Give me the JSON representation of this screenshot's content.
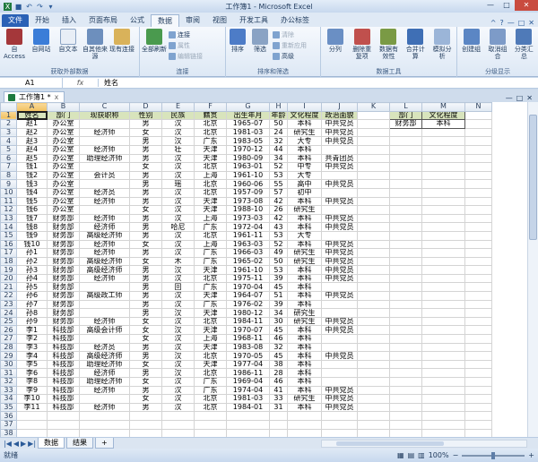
{
  "app": {
    "title": "工作簿1 - Microsoft Excel"
  },
  "tabs": [
    "文件",
    "开始",
    "插入",
    "页面布局",
    "公式",
    "数据",
    "审阅",
    "视图",
    "开发工具",
    "办公标签"
  ],
  "active_tab": "数据",
  "ribbon": {
    "external": {
      "name": "获取外部数据",
      "buttons": [
        "自 Access",
        "自网站",
        "自文本",
        "自其他来源",
        "现有连接"
      ]
    },
    "connections": {
      "name": "连接",
      "big": "全部刷新",
      "small": [
        "连接",
        "属性",
        "编辑链接"
      ]
    },
    "sortfilter": {
      "name": "排序和筛选",
      "big": [
        "排序",
        "筛选"
      ],
      "small": [
        "清除",
        "重新应用",
        "高级"
      ]
    },
    "datatools": {
      "name": "数据工具",
      "big": [
        "分列",
        "删除重复项",
        "数据有效性",
        "合并计算",
        "模拟分析"
      ]
    },
    "outline": {
      "name": "分级显示",
      "big": [
        "创建组",
        "取消组合",
        "分类汇总"
      ]
    }
  },
  "formula": {
    "namebox": "A1",
    "fx": "fx",
    "value": "姓名"
  },
  "workbook_tab": {
    "label": "工作簿1 *",
    "close": "x"
  },
  "grid": {
    "columns": [
      "A",
      "B",
      "C",
      "D",
      "E",
      "F",
      "G",
      "H",
      "I",
      "J",
      "K",
      "L",
      "M",
      "N"
    ],
    "rows": [
      [
        "姓名",
        "部门",
        "现获职称",
        "性别",
        "民族",
        "籍贯",
        "出生年月",
        "年龄",
        "文化程度",
        "政治面貌",
        "",
        "部门",
        "文化程度",
        ""
      ],
      [
        "赵1",
        "办公室",
        "",
        "男",
        "汉",
        "北京",
        "1965-07",
        "50",
        "本科",
        "中共党员",
        "",
        "财务部",
        "本科",
        ""
      ],
      [
        "赵2",
        "办公室",
        "经济师",
        "女",
        "汉",
        "北京",
        "1981-03",
        "24",
        "研究生",
        "中共党员",
        "",
        "",
        "",
        ""
      ],
      [
        "赵3",
        "办公室",
        "",
        "男",
        "汉",
        "广东",
        "1983-05",
        "32",
        "大专",
        "中共党员",
        "",
        "",
        "",
        ""
      ],
      [
        "赵4",
        "办公室",
        "经济师",
        "男",
        "壮",
        "天津",
        "1970-12",
        "44",
        "本科",
        "",
        "",
        "",
        "",
        ""
      ],
      [
        "赵5",
        "办公室",
        "助理经济师",
        "男",
        "汉",
        "天津",
        "1980-09",
        "34",
        "本科",
        "共青团员",
        "",
        "",
        "",
        ""
      ],
      [
        "钱1",
        "办公室",
        "",
        "女",
        "汉",
        "北京",
        "1963-01",
        "52",
        "中专",
        "中共党员",
        "",
        "",
        "",
        ""
      ],
      [
        "钱2",
        "办公室",
        "会计员",
        "男",
        "汉",
        "上海",
        "1961-10",
        "53",
        "大专",
        "",
        "",
        "",
        "",
        ""
      ],
      [
        "钱3",
        "办公室",
        "",
        "男",
        "瑶",
        "北京",
        "1960-06",
        "55",
        "高中",
        "中共党员",
        "",
        "",
        "",
        ""
      ],
      [
        "钱4",
        "办公室",
        "经济员",
        "男",
        "汉",
        "北京",
        "1957-09",
        "57",
        "初中",
        "",
        "",
        "",
        "",
        ""
      ],
      [
        "钱5",
        "办公室",
        "经济师",
        "男",
        "汉",
        "天津",
        "1973-08",
        "42",
        "本科",
        "中共党员",
        "",
        "",
        "",
        ""
      ],
      [
        "钱6",
        "办公室",
        "",
        "女",
        "汉",
        "天津",
        "1988-10",
        "26",
        "研究生",
        "",
        "",
        "",
        "",
        ""
      ],
      [
        "钱7",
        "财务部",
        "经济师",
        "男",
        "汉",
        "上海",
        "1973-03",
        "42",
        "本科",
        "中共党员",
        "",
        "",
        "",
        ""
      ],
      [
        "钱8",
        "财务部",
        "经济师",
        "男",
        "哈尼",
        "广东",
        "1972-04",
        "43",
        "本科",
        "中共党员",
        "",
        "",
        "",
        ""
      ],
      [
        "钱9",
        "财务部",
        "高级经济师",
        "男",
        "汉",
        "北京",
        "1961-11",
        "53",
        "大专",
        "",
        "",
        "",
        "",
        ""
      ],
      [
        "钱10",
        "财务部",
        "经济师",
        "女",
        "汉",
        "上海",
        "1963-03",
        "52",
        "本科",
        "中共党员",
        "",
        "",
        "",
        ""
      ],
      [
        "孙1",
        "财务部",
        "经济师",
        "男",
        "汉",
        "广东",
        "1966-03",
        "49",
        "研究生",
        "中共党员",
        "",
        "",
        "",
        ""
      ],
      [
        "孙2",
        "财务部",
        "高级经济师",
        "女",
        "木",
        "广东",
        "1965-02",
        "50",
        "研究生",
        "中共党员",
        "",
        "",
        "",
        ""
      ],
      [
        "孙3",
        "财务部",
        "高级经济师",
        "男",
        "汉",
        "天津",
        "1961-10",
        "53",
        "本科",
        "中共党员",
        "",
        "",
        "",
        ""
      ],
      [
        "孙4",
        "财务部",
        "经济师",
        "男",
        "汉",
        "北京",
        "1975-11",
        "39",
        "本科",
        "中共党员",
        "",
        "",
        "",
        ""
      ],
      [
        "孙5",
        "财务部",
        "",
        "男",
        "回",
        "广东",
        "1970-04",
        "45",
        "本科",
        "",
        "",
        "",
        "",
        ""
      ],
      [
        "孙6",
        "财务部",
        "高级政工师",
        "男",
        "汉",
        "天津",
        "1964-07",
        "51",
        "本科",
        "中共党员",
        "",
        "",
        "",
        ""
      ],
      [
        "孙7",
        "财务部",
        "",
        "男",
        "汉",
        "广东",
        "1976-02",
        "39",
        "本科",
        "",
        "",
        "",
        "",
        ""
      ],
      [
        "孙8",
        "财务部",
        "",
        "男",
        "汉",
        "天津",
        "1980-12",
        "34",
        "研究生",
        "",
        "",
        "",
        "",
        ""
      ],
      [
        "孙9",
        "财务部",
        "经济师",
        "女",
        "汉",
        "北京",
        "1984-11",
        "30",
        "研究生",
        "中共党员",
        "",
        "",
        "",
        ""
      ],
      [
        "李1",
        "科技部",
        "高级会计师",
        "女",
        "汉",
        "天津",
        "1970-07",
        "45",
        "本科",
        "中共党员",
        "",
        "",
        "",
        ""
      ],
      [
        "李2",
        "科技部",
        "",
        "女",
        "汉",
        "上海",
        "1968-11",
        "46",
        "本科",
        "",
        "",
        "",
        "",
        ""
      ],
      [
        "李3",
        "科技部",
        "经济员",
        "男",
        "汉",
        "天津",
        "1983-08",
        "32",
        "本科",
        "",
        "",
        "",
        "",
        ""
      ],
      [
        "李4",
        "科技部",
        "高级经济师",
        "男",
        "汉",
        "北京",
        "1970-05",
        "45",
        "本科",
        "中共党员",
        "",
        "",
        "",
        ""
      ],
      [
        "李5",
        "科技部",
        "助理经济师",
        "女",
        "汉",
        "天津",
        "1977-04",
        "38",
        "本科",
        "",
        "",
        "",
        "",
        ""
      ],
      [
        "李6",
        "科技部",
        "经济师",
        "男",
        "汉",
        "北京",
        "1986-11",
        "28",
        "本科",
        "",
        "",
        "",
        "",
        ""
      ],
      [
        "李8",
        "科技部",
        "助理经济师",
        "女",
        "汉",
        "广东",
        "1969-04",
        "46",
        "本科",
        "",
        "",
        "",
        "",
        ""
      ],
      [
        "李9",
        "科技部",
        "经济师",
        "男",
        "汉",
        "广东",
        "1974-04",
        "41",
        "本科",
        "中共党员",
        "",
        "",
        "",
        ""
      ],
      [
        "李10",
        "科技部",
        "",
        "女",
        "汉",
        "北京",
        "1981-03",
        "33",
        "研究生",
        "中共党员",
        "",
        "",
        "",
        ""
      ],
      [
        "李11",
        "科技部",
        "经济师",
        "男",
        "汉",
        "北京",
        "1984-01",
        "31",
        "本科",
        "中共党员",
        "",
        "",
        "",
        ""
      ],
      [
        "",
        "",
        "",
        "",
        "",
        "",
        "",
        "",
        "",
        "",
        "",
        "",
        "",
        ""
      ],
      [
        "",
        "",
        "",
        "",
        "",
        "",
        "",
        "",
        "",
        "",
        "",
        "",
        "",
        ""
      ],
      [
        "",
        "",
        "",
        "",
        "",
        "",
        "",
        "",
        "",
        "",
        "",
        "",
        "",
        ""
      ]
    ]
  },
  "sheets": [
    "数据",
    "结果"
  ],
  "active_sheet": "数据",
  "status": {
    "ready": "就绪",
    "zoom": "100%"
  }
}
